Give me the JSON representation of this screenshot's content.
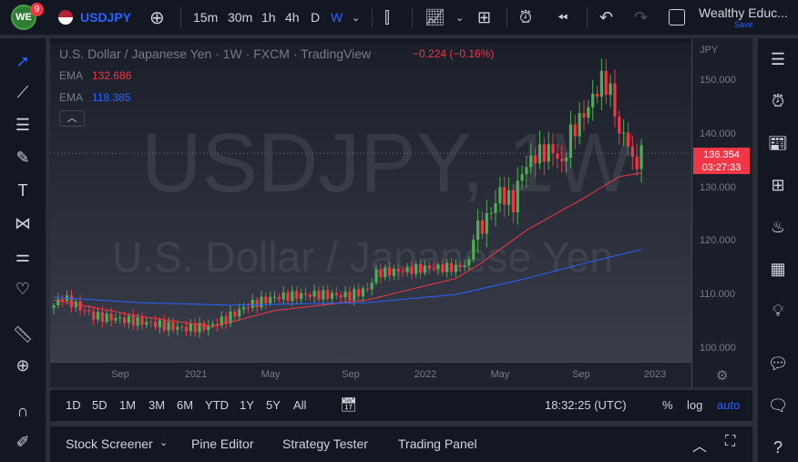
{
  "header": {
    "symbol": "USDJPY",
    "notification_count": "9",
    "timeframes": [
      "15m",
      "30m",
      "1h",
      "4h",
      "D",
      "W"
    ],
    "active_timeframe": "W",
    "layout_name": "Wealthy Educ...",
    "save_label": "Save"
  },
  "legend": {
    "title": "U.S. Dollar / Japanese Yen · 1W · FXCM · TradingView",
    "change": "−0.224 (−0.16%)",
    "ema": [
      {
        "label": "EMA",
        "value": "132.686",
        "color": "#f23645"
      },
      {
        "label": "EMA",
        "value": "118.385",
        "color": "#2962ff"
      }
    ]
  },
  "watermark": {
    "line1": "USDJPY, 1W",
    "line2": "U.S. Dollar / Japanese Yen"
  },
  "price_axis": {
    "currency": "JPY",
    "ticks": [
      "150.000",
      "140.000",
      "130.000",
      "120.000",
      "110.000",
      "100.000"
    ],
    "last_price": "136.354",
    "countdown": "03:27:33"
  },
  "time_axis": {
    "ticks": [
      "Sep",
      "2021",
      "May",
      "Sep",
      "2022",
      "May",
      "Sep",
      "2023"
    ]
  },
  "bottom_toolbar": {
    "ranges": [
      "1D",
      "5D",
      "1M",
      "3M",
      "6M",
      "YTD",
      "1Y",
      "5Y",
      "All"
    ],
    "clock": "18:32:25 (UTC)",
    "percent": "%",
    "log": "log",
    "auto": "auto"
  },
  "panel_tabs": [
    "Stock Screener",
    "Pine Editor",
    "Strategy Tester",
    "Trading Panel"
  ],
  "colors": {
    "up": "#26a69a",
    "up_green": "#4caf50",
    "down": "#f23645",
    "ema_fast": "#f23645",
    "ema_slow": "#2962ff",
    "accent": "#2962ff"
  },
  "chart_data": {
    "type": "candlestick",
    "title": "USDJPY 1W",
    "ylim": [
      97,
      156
    ],
    "weeks": 134,
    "close_anchors": [
      [
        0,
        108
      ],
      [
        2,
        109.5
      ],
      [
        9,
        106
      ],
      [
        19,
        105
      ],
      [
        29,
        103.7
      ],
      [
        35,
        104
      ],
      [
        39,
        105.5
      ],
      [
        44,
        108
      ],
      [
        50,
        109.5
      ],
      [
        58,
        110
      ],
      [
        67,
        109.8
      ],
      [
        71,
        111
      ],
      [
        73,
        114
      ],
      [
        79,
        114.5
      ],
      [
        85,
        115
      ],
      [
        91,
        115
      ],
      [
        94,
        116
      ],
      [
        95,
        121
      ],
      [
        98,
        124
      ],
      [
        101,
        129
      ],
      [
        104,
        127
      ],
      [
        106,
        133
      ],
      [
        109,
        136
      ],
      [
        113,
        137
      ],
      [
        115,
        134
      ],
      [
        117,
        140
      ],
      [
        121,
        145
      ],
      [
        124,
        150
      ],
      [
        126,
        148
      ],
      [
        128,
        140
      ],
      [
        130,
        139
      ],
      [
        131,
        134
      ],
      [
        133,
        136.4
      ]
    ],
    "ema_fast_anchors": [
      [
        0,
        109
      ],
      [
        19,
        106
      ],
      [
        36,
        104
      ],
      [
        50,
        107
      ],
      [
        71,
        109
      ],
      [
        81,
        111
      ],
      [
        91,
        113
      ],
      [
        97,
        116
      ],
      [
        107,
        122
      ],
      [
        120,
        128
      ],
      [
        128,
        132
      ],
      [
        133,
        132.7
      ]
    ],
    "ema_slow_anchors": [
      [
        0,
        109.5
      ],
      [
        19,
        108.5
      ],
      [
        40,
        108
      ],
      [
        71,
        108.5
      ],
      [
        91,
        110
      ],
      [
        107,
        113
      ],
      [
        121,
        116
      ],
      [
        133,
        118.4
      ]
    ]
  }
}
